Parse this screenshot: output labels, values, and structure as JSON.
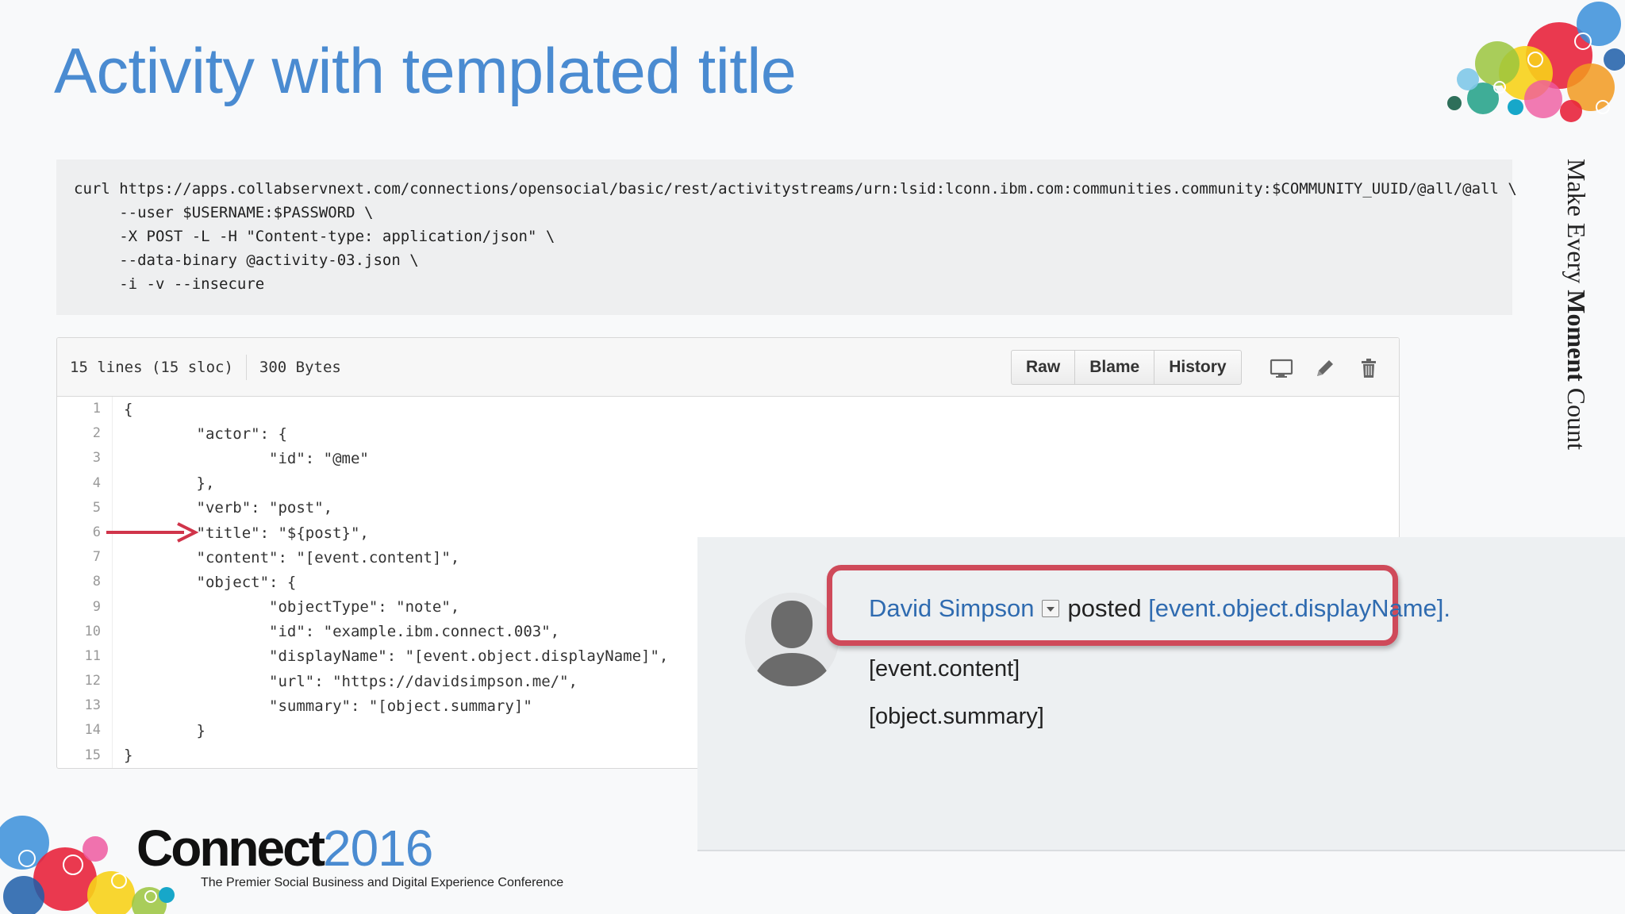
{
  "slide": {
    "title": "Activity with templated title",
    "side_text_pre": "Make Every ",
    "side_text_bold": "Moment",
    "side_text_post": " Count"
  },
  "command": {
    "lines": [
      "curl https://apps.collabservnext.com/connections/opensocial/basic/rest/activitystreams/urn:lsid:lconn.ibm.com:communities.community:$COMMUNITY_UUID/@all/@all \\",
      "     --user $USERNAME:$PASSWORD \\",
      "     -X POST -L -H \"Content-type: application/json\" \\",
      "     --data-binary @activity-03.json \\",
      "     -i -v --insecure"
    ]
  },
  "file_view": {
    "lines_info": "15 lines (15 sloc)",
    "size_info": "300 Bytes",
    "buttons": {
      "raw": "Raw",
      "blame": "Blame",
      "history": "History"
    },
    "code": [
      {
        "n": "1",
        "text": "{"
      },
      {
        "n": "2",
        "text": "        \"actor\": {"
      },
      {
        "n": "3",
        "text": "                \"id\": \"@me\""
      },
      {
        "n": "4",
        "text": "        },"
      },
      {
        "n": "5",
        "text": "        \"verb\": \"post\","
      },
      {
        "n": "6",
        "text": "        \"title\": \"${post}\","
      },
      {
        "n": "7",
        "text": "        \"content\": \"[event.content]\","
      },
      {
        "n": "8",
        "text": "        \"object\": {"
      },
      {
        "n": "9",
        "text": "                \"objectType\": \"note\","
      },
      {
        "n": "10",
        "text": "                \"id\": \"example.ibm.connect.003\","
      },
      {
        "n": "11",
        "text": "                \"displayName\": \"[event.object.displayName]\","
      },
      {
        "n": "12",
        "text": "                \"url\": \"https://davidsimpson.me/\","
      },
      {
        "n": "13",
        "text": "                \"summary\": \"[object.summary]\""
      },
      {
        "n": "14",
        "text": "        }"
      },
      {
        "n": "15",
        "text": "}"
      }
    ]
  },
  "preview": {
    "actor_name": "David Simpson",
    "verb_text": "posted",
    "object_link": "[event.object.displayName]",
    "period": ".",
    "content": "[event.content]",
    "summary": "[object.summary]"
  },
  "branding": {
    "logo_word": "Connect",
    "logo_year": "2016",
    "tagline": "The Premier Social Business and Digital Experience Conference"
  },
  "colors": {
    "title_blue": "#4a8bd1",
    "link_blue": "#2f6bb0",
    "highlight_red": "#cf4a5a",
    "arrow_red": "#d0344a"
  }
}
